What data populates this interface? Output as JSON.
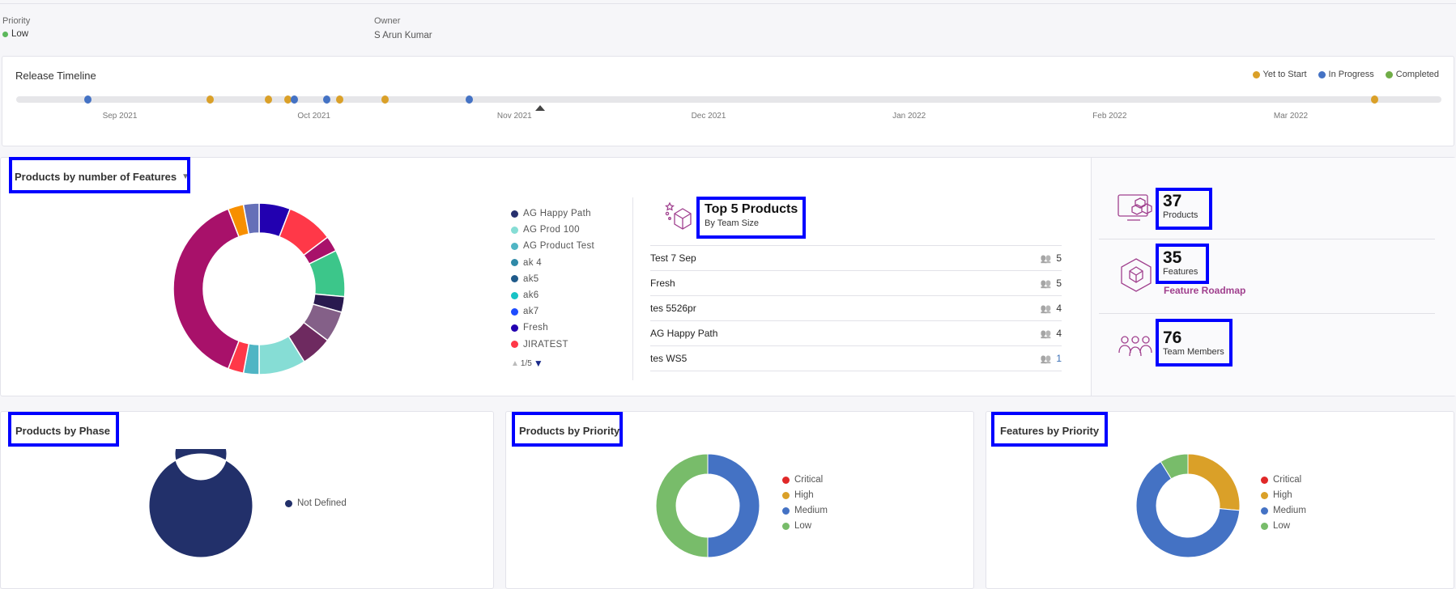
{
  "header": {
    "priority_label": "Priority",
    "priority_value": "Low",
    "priority_color": "#5cb85c",
    "owner_label": "Owner",
    "owner_value": "S Arun Kumar"
  },
  "timeline": {
    "title": "Release Timeline",
    "legend": [
      {
        "label": "Yet to Start",
        "color": "#daa028"
      },
      {
        "label": "In Progress",
        "color": "#4472c4"
      },
      {
        "label": "Completed",
        "color": "#70ad47"
      }
    ],
    "months": [
      {
        "label": "Sep 2021",
        "date": "2021-09-01"
      },
      {
        "label": "Oct 2021",
        "date": "2021-10-01"
      },
      {
        "label": "Nov 2021",
        "date": "2021-11-01"
      },
      {
        "label": "Dec 2021",
        "date": "2021-12-01"
      },
      {
        "label": "Jan 2022",
        "date": "2022-01-01"
      },
      {
        "label": "Feb 2022",
        "date": "2022-02-01"
      },
      {
        "label": "Mar 2022",
        "date": "2022-03-01"
      }
    ],
    "releases": [
      {
        "date": "2021-08-27",
        "status": "In Progress"
      },
      {
        "date": "2021-09-15",
        "status": "Yet to Start"
      },
      {
        "date": "2021-09-24",
        "status": "Yet to Start"
      },
      {
        "date": "2021-09-27",
        "status": "Yet to Start"
      },
      {
        "date": "2021-09-28",
        "status": "In Progress"
      },
      {
        "date": "2021-10-03",
        "status": "In Progress"
      },
      {
        "date": "2021-10-05",
        "status": "Yet to Start"
      },
      {
        "date": "2021-10-12",
        "status": "Yet to Start"
      },
      {
        "date": "2021-10-25",
        "status": "In Progress"
      },
      {
        "date": "2022-03-14",
        "status": "Yet to Start"
      }
    ],
    "today": "2021-11-05"
  },
  "features_chart": {
    "title": "Products by number of Features",
    "legend": [
      {
        "label": "AG Happy Path",
        "color": "#27306e"
      },
      {
        "label": "AG Prod 100",
        "color": "#86ddd5"
      },
      {
        "label": "AG Product Test",
        "color": "#4fb5c4"
      },
      {
        "label": "ak 4",
        "color": "#2f8aa8"
      },
      {
        "label": "ak5",
        "color": "#1f5a8a"
      },
      {
        "label": "ak6",
        "color": "#17c3c6"
      },
      {
        "label": "ak7",
        "color": "#1e4cff"
      },
      {
        "label": "Fresh",
        "color": "#2200b0"
      },
      {
        "label": "JIRATEST",
        "color": "#ff3848"
      }
    ],
    "pager": "1/5"
  },
  "chart_data": [
    {
      "type": "pie",
      "title": "Products by number of Features",
      "values": [
        2,
        3,
        1,
        3,
        1,
        2,
        2,
        3,
        1,
        1,
        13,
        1,
        1
      ],
      "colors": [
        "#2200b0",
        "#ff3848",
        "#a8116a",
        "#3cc68a",
        "#291a4f",
        "#846088",
        "#6e2a60",
        "#86ddd5",
        "#4fb5c4",
        "#ff3848",
        "#a8116a",
        "#f78f00",
        "#6670b8"
      ]
    },
    {
      "type": "pie",
      "title": "Products by Phase",
      "categories": [
        "Not Defined"
      ],
      "values": [
        1
      ],
      "colors": [
        "#22306a"
      ]
    },
    {
      "type": "pie",
      "title": "Products by Priority",
      "categories": [
        "Critical",
        "High",
        "Medium",
        "Low"
      ],
      "values": [
        0,
        0,
        1,
        1
      ],
      "colors": [
        "#e02828",
        "#daa028",
        "#4472c4",
        "#78bc6a"
      ]
    },
    {
      "type": "pie",
      "title": "Features by Priority",
      "categories": [
        "Critical",
        "High",
        "Medium",
        "Low"
      ],
      "values": [
        0,
        9,
        22,
        3
      ],
      "colors": [
        "#e02828",
        "#daa028",
        "#4472c4",
        "#78bc6a"
      ]
    }
  ],
  "top5": {
    "title": "Top 5 Products",
    "subtitle": "By Team Size",
    "rows": [
      {
        "name": "Test 7 Sep",
        "count": "5"
      },
      {
        "name": "Fresh",
        "count": "5"
      },
      {
        "name": "tes 5526pr",
        "count": "4"
      },
      {
        "name": "AG Happy Path",
        "count": "4"
      },
      {
        "name": "tes WS5",
        "count": "1"
      }
    ]
  },
  "stats": {
    "products": {
      "value": "37",
      "label": "Products"
    },
    "features": {
      "value": "35",
      "label": "Features",
      "link": "Feature Roadmap"
    },
    "members": {
      "value": "76",
      "label": "Team Members"
    },
    "accent": "#a0408e"
  },
  "phase": {
    "title": "Products by Phase",
    "legend": [
      {
        "label": "Not Defined",
        "color": "#22306a"
      }
    ]
  },
  "prod_priority": {
    "title": "Products by Priority",
    "legend": [
      {
        "label": "Critical",
        "color": "#e02828"
      },
      {
        "label": "High",
        "color": "#daa028"
      },
      {
        "label": "Medium",
        "color": "#4472c4"
      },
      {
        "label": "Low",
        "color": "#78bc6a"
      }
    ]
  },
  "feat_priority": {
    "title": "Features by Priority",
    "legend": [
      {
        "label": "Critical",
        "color": "#e02828"
      },
      {
        "label": "High",
        "color": "#daa028"
      },
      {
        "label": "Medium",
        "color": "#4472c4"
      },
      {
        "label": "Low",
        "color": "#78bc6a"
      }
    ]
  }
}
